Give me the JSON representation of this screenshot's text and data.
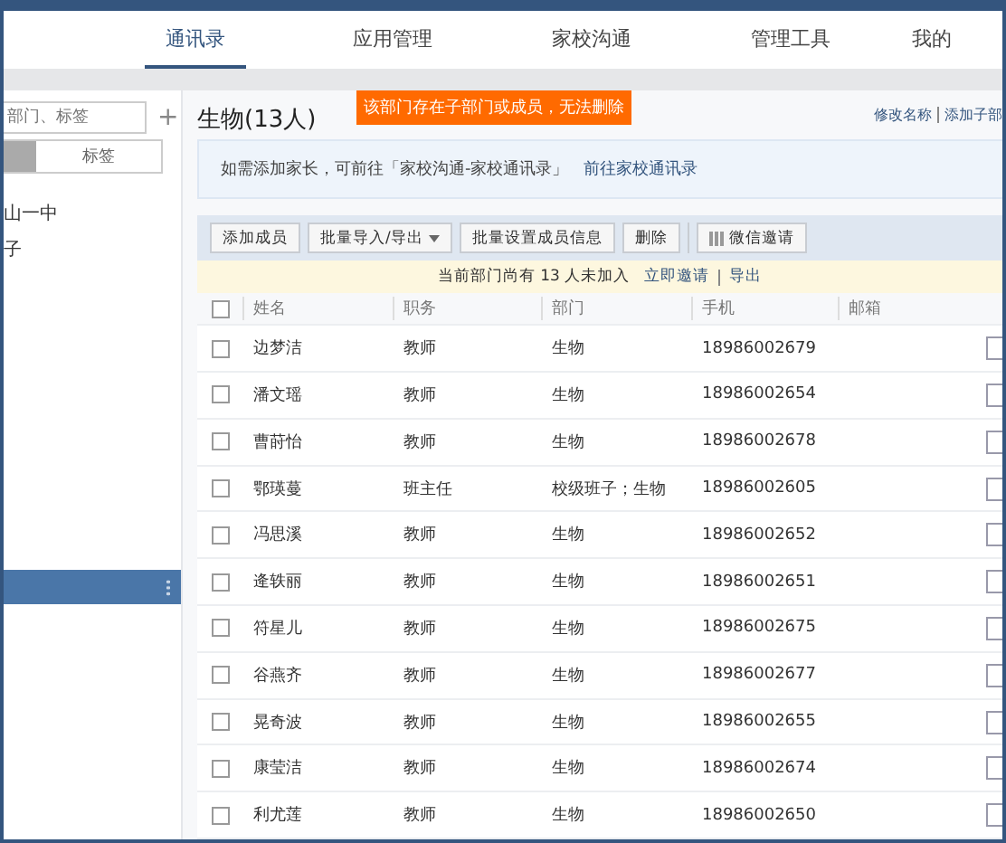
{
  "nav": {
    "tabs": [
      {
        "label": "通讯录",
        "selected": true
      },
      {
        "label": "应用管理",
        "selected": false
      },
      {
        "label": "家校沟通",
        "selected": false
      },
      {
        "label": "管理工具",
        "selected": false
      },
      {
        "label": "我的",
        "selected": false
      }
    ]
  },
  "sidebar": {
    "search": {
      "placeholder": "部门、标签"
    },
    "add": "+",
    "tabs": [
      {
        "selected": true
      },
      {
        "label": "标签",
        "selected": false
      }
    ],
    "items": [
      {
        "label": "山一中",
        "selected": false
      },
      {
        "label": "子",
        "selected": false
      },
      {
        "selected": true
      }
    ]
  },
  "toast": "该部门存在子部门或成员，无法删除",
  "title": "生物(13人)",
  "links": [
    "修改名称",
    "添加子部"
  ],
  "info": {
    "text": "如需添加家长，可前往「家校沟通-家校通讯录」",
    "link": "前往家校通讯录"
  },
  "toolbar": [
    {
      "label": "添加成员",
      "kind": "plain"
    },
    {
      "label": "批量导入/导出",
      "kind": "dropdown"
    },
    {
      "label": "批量设置成员信息",
      "kind": "plain"
    },
    {
      "label": "删除",
      "kind": "plain"
    },
    {
      "label": "微信邀请",
      "kind": "qr"
    }
  ],
  "notice": {
    "text": "当前部门尚有 13 人未加入",
    "links": [
      "立即邀请",
      "导出"
    ]
  },
  "table": {
    "select_all_checked": false,
    "columns": [
      "姓名",
      "职务",
      "部门",
      "手机",
      "邮箱"
    ],
    "rows": [
      {
        "cells": [
          "边梦洁",
          "教师",
          "生物",
          "18986002679",
          ""
        ],
        "checked": false
      },
      {
        "cells": [
          "潘文瑶",
          "教师",
          "生物",
          "18986002654",
          ""
        ],
        "checked": false
      },
      {
        "cells": [
          "曹莳怡",
          "教师",
          "生物",
          "18986002678",
          ""
        ],
        "checked": false
      },
      {
        "cells": [
          "鄂瑛蔓",
          "班主任",
          "校级班子；生物",
          "18986002605",
          ""
        ],
        "checked": false
      },
      {
        "cells": [
          "冯思溪",
          "教师",
          "生物",
          "18986002652",
          ""
        ],
        "checked": false
      },
      {
        "cells": [
          "逄轶丽",
          "教师",
          "生物",
          "18986002651",
          ""
        ],
        "checked": false
      },
      {
        "cells": [
          "符星儿",
          "教师",
          "生物",
          "18986002675",
          ""
        ],
        "checked": false
      },
      {
        "cells": [
          "谷燕齐",
          "教师",
          "生物",
          "18986002677",
          ""
        ],
        "checked": false
      },
      {
        "cells": [
          "晃奇波",
          "教师",
          "生物",
          "18986002655",
          ""
        ],
        "checked": false
      },
      {
        "cells": [
          "康莹洁",
          "教师",
          "生物",
          "18986002674",
          ""
        ],
        "checked": false
      },
      {
        "cells": [
          "利尤莲",
          "教师",
          "生物",
          "18986002650",
          ""
        ],
        "checked": false
      }
    ]
  }
}
